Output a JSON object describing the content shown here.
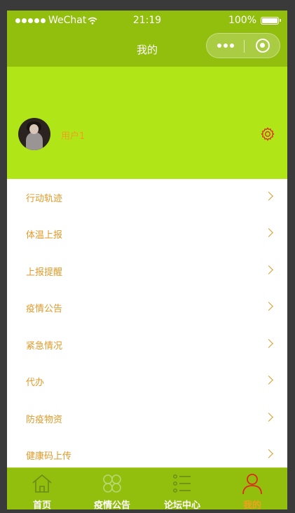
{
  "status_bar": {
    "carrier": "WeChat",
    "time": "21:19",
    "battery": "100%"
  },
  "nav": {
    "title": "我的"
  },
  "profile": {
    "username": "用户1"
  },
  "menu": [
    {
      "label": "行动轨迹"
    },
    {
      "label": "体温上报"
    },
    {
      "label": "上报提醒"
    },
    {
      "label": "疫情公告"
    },
    {
      "label": "紧急情况"
    },
    {
      "label": "代办"
    },
    {
      "label": "防疫物资"
    },
    {
      "label": "健康码上传"
    }
  ],
  "tabs": [
    {
      "label": "首页",
      "icon": "home-icon",
      "active": false
    },
    {
      "label": "疫情公告",
      "icon": "grid-icon",
      "active": false
    },
    {
      "label": "论坛中心",
      "icon": "list-icon",
      "active": false
    },
    {
      "label": "我的",
      "icon": "user-icon",
      "active": true
    }
  ],
  "colors": {
    "header_green": "#92be0e",
    "profile_green": "#b0e617",
    "accent_orange": "#e09a2a",
    "active_tab_icon": "#e0281a"
  }
}
